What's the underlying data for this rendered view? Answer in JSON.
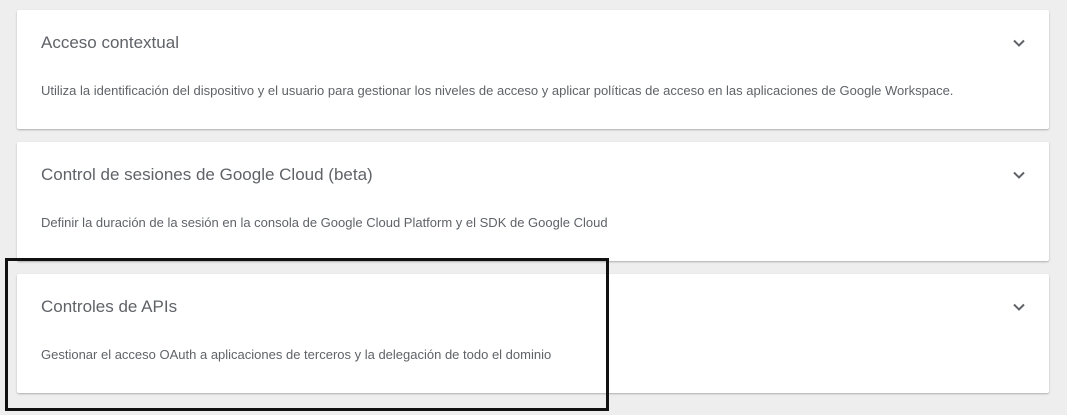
{
  "cards": [
    {
      "title": "Acceso contextual",
      "description": "Utiliza la identificación del dispositivo y el usuario para gestionar los niveles de acceso y aplicar políticas de acceso en las aplicaciones de Google Workspace.",
      "icon": "chevron-down-icon"
    },
    {
      "title": "Control de sesiones de Google Cloud (beta)",
      "description": "Definir la duración de la sesión en la consola de Google Cloud Platform y el SDK de Google Cloud",
      "icon": "chevron-down-icon"
    },
    {
      "title": "Controles de APIs",
      "description": "Gestionar el acceso OAuth a aplicaciones de terceros y la delegación de todo el dominio",
      "icon": "chevron-down-icon"
    }
  ],
  "colors": {
    "background": "#eeeeee",
    "card": "#ffffff",
    "text": "#5f6368",
    "highlight": "#111111"
  }
}
